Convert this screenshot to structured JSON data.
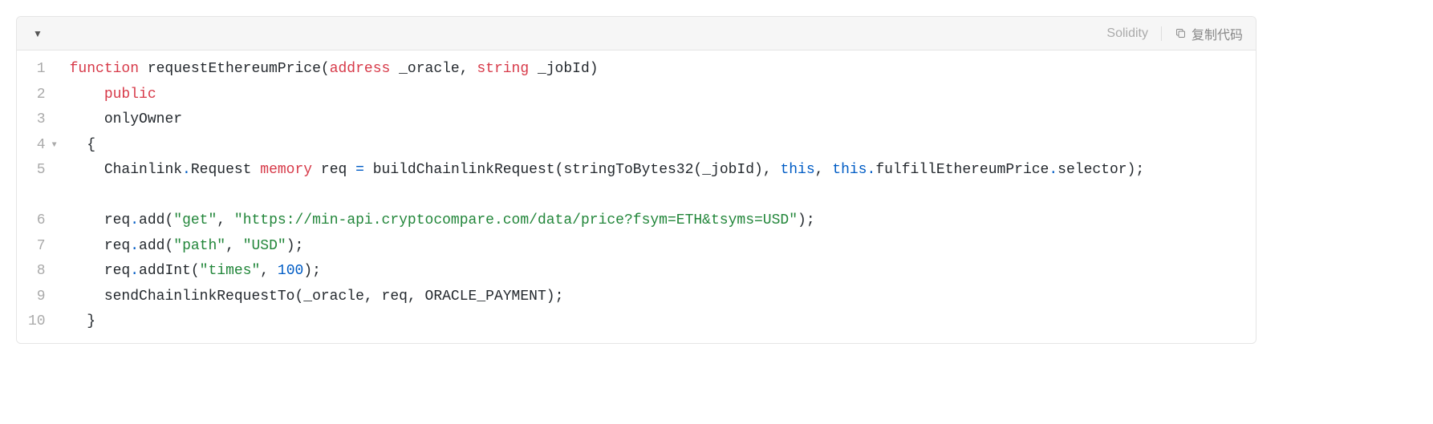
{
  "header": {
    "language": "Solidity",
    "copy_label": "复制代码"
  },
  "gutter": {
    "lines": [
      "1",
      "2",
      "3",
      "4",
      "5",
      "6",
      "7",
      "8",
      "9",
      "10"
    ],
    "fold_at": 4
  },
  "code": {
    "line1": {
      "kw_function": "function",
      "fn_name": " requestEthereumPrice",
      "paren_open": "(",
      "kw_address": "address",
      "param1": " _oracle",
      "comma": ", ",
      "kw_string": "string",
      "param2": " _jobId",
      "paren_close": ")"
    },
    "line2": {
      "indent": "    ",
      "kw_public": "public"
    },
    "line3": {
      "indent": "    ",
      "modifier": "onlyOwner"
    },
    "line4": {
      "indent": "  ",
      "brace": "{"
    },
    "line5": {
      "indent": "    ",
      "type_ns": "Chainlink",
      "dot1": ".",
      "type_req": "Request ",
      "kw_memory": "memory",
      "var_req": " req ",
      "eq": "=",
      "call1": " buildChainlinkRequest",
      "po1": "(",
      "call2": "stringToBytes32",
      "po2": "(",
      "arg_jobid": "_jobId",
      "pc2": ")",
      "c1": ", ",
      "kw_this1": "this",
      "c2": ", ",
      "kw_this2": "this",
      "dot2": ".",
      "member1": "fulfillEthereumPrice",
      "dot3": ".",
      "member2": "selector",
      "pc1": ")",
      "semi": ";"
    },
    "line6": {
      "indent": "    ",
      "obj": "req",
      "dot": ".",
      "method": "add",
      "po": "(",
      "str1": "\"get\"",
      "comma": ", ",
      "str2": "\"https://min-api.cryptocompare.com/data/price?fsym=ETH&tsyms=USD\"",
      "pc": ")",
      "semi": ";"
    },
    "line7": {
      "indent": "    ",
      "obj": "req",
      "dot": ".",
      "method": "add",
      "po": "(",
      "str1": "\"path\"",
      "comma": ", ",
      "str2": "\"USD\"",
      "pc": ")",
      "semi": ";"
    },
    "line8": {
      "indent": "    ",
      "obj": "req",
      "dot": ".",
      "method": "addInt",
      "po": "(",
      "str1": "\"times\"",
      "comma": ", ",
      "num": "100",
      "pc": ")",
      "semi": ";"
    },
    "line9": {
      "indent": "    ",
      "fn": "sendChainlinkRequestTo",
      "po": "(",
      "arg1": "_oracle",
      "c1": ", ",
      "arg2": "req",
      "c2": ", ",
      "arg3": "ORACLE_PAYMENT",
      "pc": ")",
      "semi": ";"
    },
    "line10": {
      "indent": "  ",
      "brace": "}"
    }
  }
}
